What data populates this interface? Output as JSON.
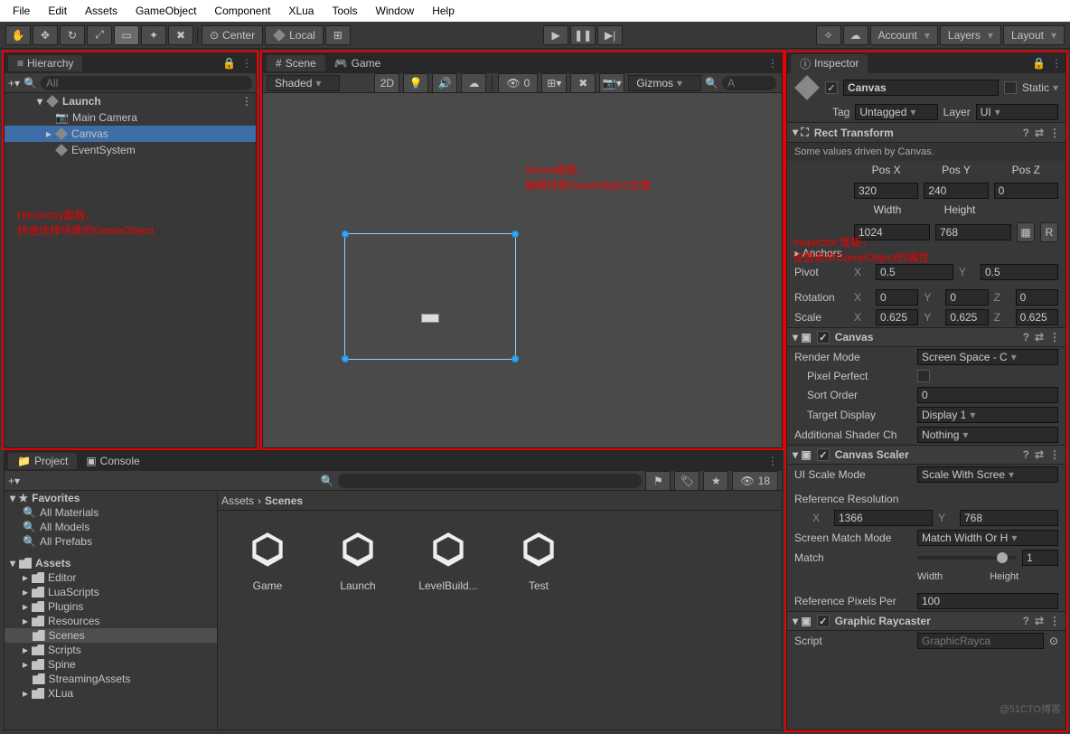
{
  "menu": [
    "File",
    "Edit",
    "Assets",
    "GameObject",
    "Component",
    "XLua",
    "Tools",
    "Window",
    "Help"
  ],
  "toolbar": {
    "center": "Center",
    "local": "Local",
    "account": "Account",
    "layers": "Layers",
    "layout": "Layout"
  },
  "hierarchy": {
    "title": "Hierarchy",
    "search_placeholder": "All",
    "scene": "Launch",
    "items": [
      "Main Camera",
      "Canvas",
      "EventSystem"
    ],
    "note1": "Hierarchy面板，",
    "note2": "快速选择场景的GameObject"
  },
  "scene": {
    "tab": "Scene",
    "game_tab": "Game",
    "shading": "Shaded",
    "two_d": "2D",
    "gizmos": "Gizmos",
    "note1": "Scene面板，",
    "note2": "编辑场景GameObject位置",
    "light_badge": "0"
  },
  "project": {
    "tab": "Project",
    "console": "Console",
    "hidden": "18",
    "favorites": "Favorites",
    "fav_items": [
      "All Materials",
      "All Models",
      "All Prefabs"
    ],
    "assets": "Assets",
    "folders": [
      "Editor",
      "LuaScripts",
      "Plugins",
      "Resources",
      "Scenes",
      "Scripts",
      "Spine",
      "StreamingAssets",
      "XLua"
    ],
    "breadcrumb": [
      "Assets",
      "Scenes"
    ],
    "grid": [
      "Game",
      "Launch",
      "LevelBuild...",
      "Test"
    ]
  },
  "inspector": {
    "title": "Inspector",
    "name": "Canvas",
    "static": "Static",
    "tag": "Tag",
    "tag_val": "Untagged",
    "layer": "Layer",
    "layer_val": "UI",
    "note1": "Inspector 面板，",
    "note2": "设置选中GameObject的属性",
    "rect": {
      "title": "Rect Transform",
      "driven": "Some values driven by Canvas.",
      "posx": "Pos X",
      "posy": "Pos Y",
      "posz": "Pos Z",
      "px": "320",
      "py": "240",
      "pz": "0",
      "width": "Width",
      "height": "Height",
      "w": "1024",
      "h": "768",
      "anchors": "Anchors",
      "pivot": "Pivot",
      "pvx": "0.5",
      "pvy": "0.5",
      "rotation": "Rotation",
      "rx": "0",
      "ry": "0",
      "rz": "0",
      "scale": "Scale",
      "sx": "0.625",
      "sy": "0.625",
      "sz": "0.625",
      "r_btn": "R"
    },
    "canvas": {
      "title": "Canvas",
      "render": "Render Mode",
      "render_val": "Screen Space - C",
      "pixel": "Pixel Perfect",
      "sort": "Sort Order",
      "sort_val": "0",
      "target": "Target Display",
      "target_val": "Display 1",
      "shader": "Additional Shader Ch",
      "shader_val": "Nothing"
    },
    "scaler": {
      "title": "Canvas Scaler",
      "mode": "UI Scale Mode",
      "mode_val": "Scale With Scree",
      "refres": "Reference Resolution",
      "x": "X",
      "rx": "1366",
      "y": "Y",
      "ry": "768",
      "match_mode": "Screen Match Mode",
      "match_mode_val": "Match Width Or H",
      "match": "Match",
      "match_val": "1",
      "width": "Width",
      "height": "Height",
      "refpx": "Reference Pixels Per",
      "refpx_val": "100"
    },
    "raycaster": {
      "title": "Graphic Raycaster",
      "script": "Script",
      "script_val": "GraphicRayca"
    }
  },
  "watermark": "@51CTO博客"
}
